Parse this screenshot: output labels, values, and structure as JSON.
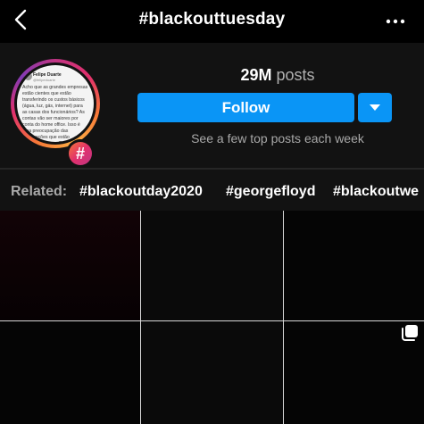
{
  "topbar": {
    "title": "#blackouttuesday",
    "back_icon": "chevron-left-icon",
    "more_icon": "more-horizontal-icon"
  },
  "header": {
    "posts_count": "29M",
    "posts_label": "posts",
    "follow_label": "Follow",
    "tagline": "See a few top posts each week",
    "avatar": {
      "author": "Felipe Duarte",
      "handle": "@felipeduarte",
      "text": "Acho que as grandes empresas estão cientes que estão transferindo os custos básicos (água, luz, gás, internet) para as casas dos funcionários? As contas vão ser maiores por conta do home office. Isso é uma preocupação das corporações que estão adotando home office definitivo?"
    },
    "badge_symbol": "#"
  },
  "related": {
    "label": "Related:",
    "tags": [
      "#blackoutday2020",
      "#georgefloyd",
      "#blackoutwe"
    ]
  },
  "colors": {
    "accent": "#0a95f6",
    "background": "#000000",
    "panel": "#121212"
  }
}
